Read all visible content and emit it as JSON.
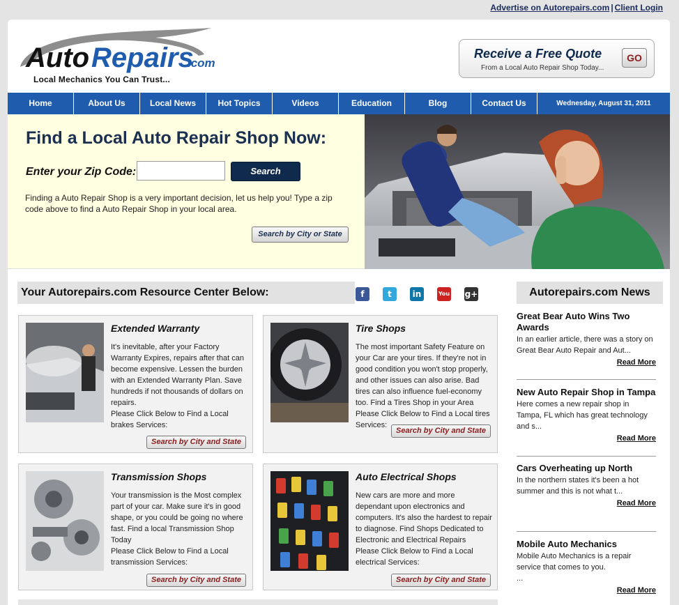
{
  "top_links": {
    "advertise": "Advertise on Autorepairs.com",
    "separator": "|",
    "client_login": "Client Login"
  },
  "logo": {
    "auto": "Auto",
    "repairs": "Repairs",
    "com": ".com",
    "tagline": "Local Mechanics You Can Trust..."
  },
  "quote": {
    "title": "Receive a Free Quote",
    "subtitle": "From a Local Auto Repair Shop Today...",
    "go": "GO"
  },
  "nav": {
    "items": [
      "Home",
      "About Us",
      "Local News",
      "Hot Topics",
      "Videos",
      "Education",
      "Blog",
      "Contact Us"
    ],
    "date": "Wednesday, August 31, 2011"
  },
  "hero": {
    "heading": "Find a Local Auto Repair Shop Now:",
    "zip_label": "Enter your Zip Code:",
    "zip_value": "",
    "search_button": "Search",
    "description": "Finding a Auto Repair Shop is a very important decision, let us help you! Type a zip code above to find a Auto Repair Shop in your local area.",
    "city_button": "Search by City or State"
  },
  "resource": {
    "title": "Your Autorepairs.com Resource Center Below:",
    "social": [
      {
        "icon": "facebook-icon",
        "glyph": "f",
        "color": "#3b5998"
      },
      {
        "icon": "twitter-icon",
        "glyph": "t",
        "color": "#33a8dc"
      },
      {
        "icon": "linkedin-icon",
        "glyph": "in",
        "color": "#0e76a8"
      },
      {
        "icon": "youtube-icon",
        "glyph": "You",
        "color": "#cc2222"
      },
      {
        "icon": "google-plus-icon",
        "glyph": "g+",
        "color": "#333333"
      }
    ],
    "cards": [
      {
        "title": "Extended Warranty",
        "body": "It's inevitable, after your Factory Warranty Expires, repairs after that can become expensive. Lessen the burden with an Extended Warranty Plan. Save hundreds if not thousands of dollars on repairs.",
        "cta": "Please Click Below to Find a Local brakes Services:",
        "button": "Search by City and State"
      },
      {
        "title": "Tire Shops",
        "body": "The most important Safety Feature on your Car are your tires. If they're not in good condition you won't stop properly, and other issues can also arise. Bad tires can also influence fuel-economy too. Find a Tires Shop in your Area",
        "cta": "Please Click Below to Find a Local tires Services:",
        "button": "Search by City and State"
      },
      {
        "title": "Transmission Shops",
        "body": "Your transmission is the Most complex part of your car. Make sure it's in good shape, or you could be going no where fast. Find a local Transmission Shop Today",
        "cta": "Please Click Below to Find a Local transmission Services:",
        "button": "Search by City and State"
      },
      {
        "title": "Auto Electrical Shops",
        "body": "New cars are more and more dependant upon electronics and computers. It's also the hardest to repair to diagnose. Find Shops Dedicated to Electronic and Electrical Repairs",
        "cta": "Please Click Below to Find a Local electrical Services:",
        "button": "Search by City and State"
      }
    ]
  },
  "news": {
    "title": "Autorepairs.com News",
    "items": [
      {
        "title": "Great Bear Auto Wins Two Awards",
        "body": "In an earlier article, there was a story on Great Bear Auto Repair and Aut...",
        "more": "Read More"
      },
      {
        "title": "New Auto Repair Shop in Tampa",
        "body": "Here comes a new repair shop in Tampa, FL which has great technology and s...",
        "more": "Read More"
      },
      {
        "title": "Cars Overheating up North",
        "body": "In the northern states it's been a hot summer and this is not what t...",
        "more": "Read More"
      },
      {
        "title": "Mobile Auto Mechanics",
        "body": "Mobile Auto Mechanics is a repair service that comes to you.\n...",
        "more": "Read More"
      }
    ]
  }
}
